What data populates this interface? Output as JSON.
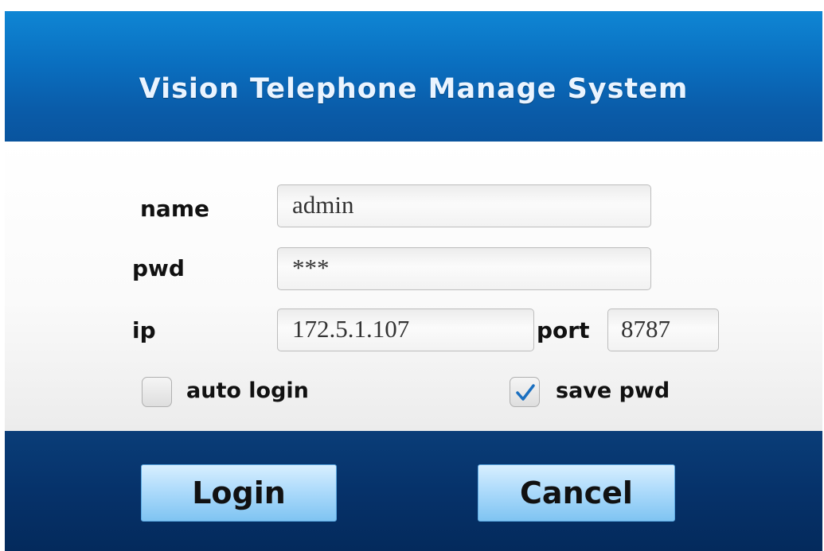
{
  "window": {
    "title": "Vision Telephone Manage System"
  },
  "form": {
    "name_label": "name",
    "name_value": "admin",
    "pwd_label": "pwd",
    "pwd_value": "***",
    "ip_label": "ip",
    "ip_value": "172.5.1.107",
    "port_label": "port",
    "port_value": "8787",
    "auto_login_label": "auto login",
    "auto_login_checked": false,
    "save_pwd_label": "save pwd",
    "save_pwd_checked": true
  },
  "buttons": {
    "login_label": "Login",
    "cancel_label": "Cancel"
  },
  "colors": {
    "header_blue": "#0a6fc0",
    "footer_navy": "#06326a",
    "button_light_blue": "#aedbfb",
    "check_blue": "#1a6fc0"
  },
  "icons": {
    "save_pwd_check": "checkmark-icon"
  }
}
